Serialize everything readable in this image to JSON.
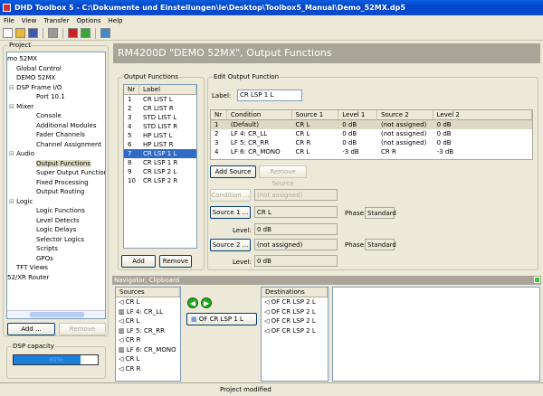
{
  "window": {
    "title": "DHD Toolbox 5 - C:\\Dokumente und Einstellungen\\le\\Desktop\\Toolbox5_Manual\\Demo_52MX.dp5"
  },
  "menu": [
    "File",
    "View",
    "Transfer",
    "Options",
    "Help"
  ],
  "toolbar": [
    "new-icon",
    "open-icon",
    "save-icon",
    "print-icon",
    "disconnect-icon",
    "connect-icon",
    "window-icon"
  ],
  "project": {
    "label": "Project",
    "tree": [
      {
        "t": "mo 52MX",
        "l": 0
      },
      {
        "t": "Global Control",
        "l": 1
      },
      {
        "t": "DEMO 52MX",
        "l": 1
      },
      {
        "t": "DSP Frame I/O",
        "l": 1,
        "exp": true
      },
      {
        "t": "Port 10.1",
        "l": 2
      },
      {
        "t": "Mixer",
        "l": 1,
        "exp": true
      },
      {
        "t": "Console",
        "l": 2
      },
      {
        "t": "Additional Modules",
        "l": 2
      },
      {
        "t": "Fader Channels",
        "l": 2
      },
      {
        "t": "Channel Assignment",
        "l": 2
      },
      {
        "t": "Audio",
        "l": 1,
        "exp": true
      },
      {
        "t": "Output Functions",
        "l": 2,
        "sel": true
      },
      {
        "t": "Super Output Functions",
        "l": 2
      },
      {
        "t": "Fixed Processing",
        "l": 2
      },
      {
        "t": "Output Routing",
        "l": 2
      },
      {
        "t": "Logic",
        "l": 1,
        "exp": true
      },
      {
        "t": "Logic Functions",
        "l": 2
      },
      {
        "t": "Level Detects",
        "l": 2
      },
      {
        "t": "Logic Delays",
        "l": 2
      },
      {
        "t": "Selector Logics",
        "l": 2
      },
      {
        "t": "Scripts",
        "l": 2
      },
      {
        "t": "GPOs",
        "l": 2
      },
      {
        "t": "TFT Views",
        "l": 1
      },
      {
        "t": "52/XR Router",
        "l": 0
      }
    ],
    "add": "Add ...",
    "remove": "Remove"
  },
  "dsp": {
    "label": "DSP capacity",
    "value": 80,
    "text": "80%"
  },
  "header": "RM4200D \"DEMO 52MX\", Output Functions",
  "output_functions": {
    "label": "Output Functions",
    "cols": [
      "Nr",
      "Label"
    ],
    "rows": [
      [
        "1",
        "CR LIST L"
      ],
      [
        "2",
        "CR LIST R"
      ],
      [
        "3",
        "STD LIST L"
      ],
      [
        "4",
        "STD LIST R"
      ],
      [
        "5",
        "HP LIST L"
      ],
      [
        "6",
        "HP LIST R"
      ],
      [
        "7",
        "CR LSP 1 L"
      ],
      [
        "8",
        "CR LSP 1 R"
      ],
      [
        "9",
        "CR LSP 2 L"
      ],
      [
        "10",
        "CR LSP 2 R"
      ]
    ],
    "selected": 6,
    "add": "Add",
    "remove": "Remove"
  },
  "edit": {
    "label": "Edit Output Function",
    "label_caption": "Label:",
    "label_value": "CR LSP 1 L",
    "cols": [
      "Nr",
      "Condition",
      "Source 1",
      "Level 1",
      "Source 2",
      "Level 2"
    ],
    "rows": [
      [
        "1",
        "(Default)",
        "CR L",
        "0 dB",
        "(not assigned)",
        "0 dB"
      ],
      [
        "2",
        "LF 4: CR_LL",
        "CR L",
        "0 dB",
        "(not assigned)",
        "0 dB"
      ],
      [
        "3",
        "LF 5: CR_RR",
        "CR R",
        "0 dB",
        "(not assigned)",
        "0 dB"
      ],
      [
        "4",
        "LF 6: CR_MONO",
        "CR L",
        "-3 dB",
        "CR R",
        "-3 dB"
      ]
    ],
    "add_source": "Add Source",
    "remove_source": "Remove Source",
    "condition_btn": "Condition ...",
    "condition_val": "(not assigned)",
    "source1_btn": "Source 1 ...",
    "source1_val": "CR L",
    "phase_caption": "Phase:",
    "phase1": "Standard",
    "level_caption": "Level:",
    "level1": "0 dB",
    "source2_btn": "Source 2 ...",
    "source2_val": "(not assigned)",
    "phase2": "Standard",
    "level2": "0 dB"
  },
  "navigator": {
    "title": "Navigator, Clipboard",
    "sources_header": "Sources",
    "sources": [
      {
        "t": "CR L",
        "i": "speaker-icon"
      },
      {
        "t": "LF 4: CR_LL",
        "i": "logic-icon"
      },
      {
        "t": "CR L",
        "i": "speaker-icon"
      },
      {
        "t": "LF 5: CR_RR",
        "i": "logic-icon"
      },
      {
        "t": "CR R",
        "i": "speaker-icon"
      },
      {
        "t": "LF 6: CR_MONO",
        "i": "logic-icon"
      },
      {
        "t": "CR L",
        "i": "speaker-icon"
      },
      {
        "t": "CR R",
        "i": "speaker-icon"
      }
    ],
    "current": "OF CR LSP 1 L",
    "destinations_header": "Destinations",
    "destinations": [
      "OF CR LSP 2 L",
      "OF CR LSP 2 L",
      "OF CR LSP 2 L",
      "OF CR LSP 2 L"
    ]
  },
  "status": "Project modified"
}
